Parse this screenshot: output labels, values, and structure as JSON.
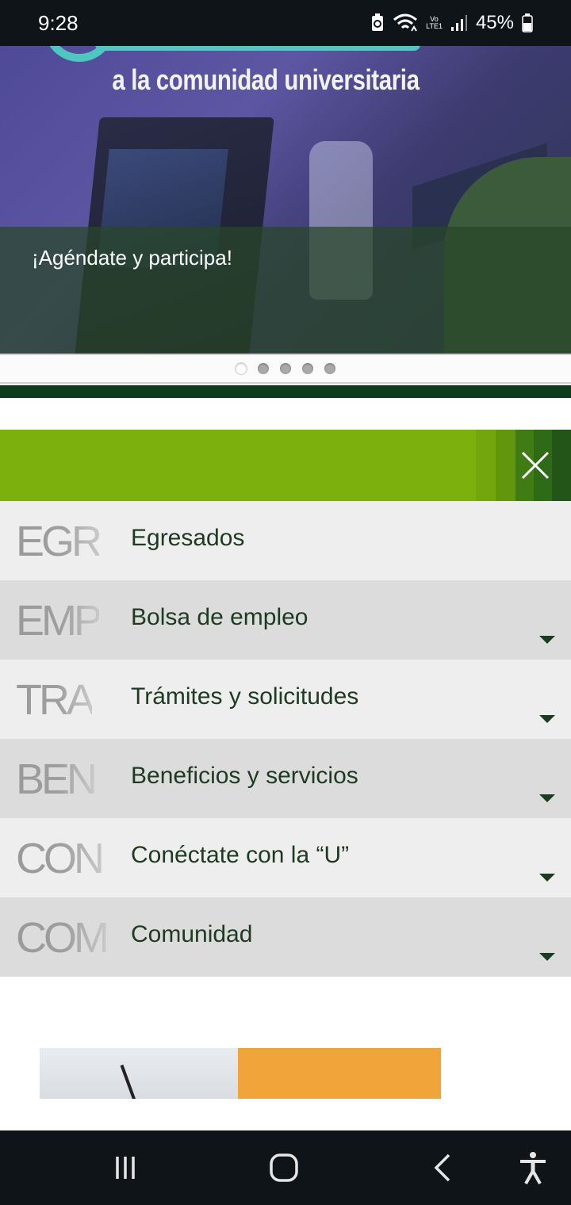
{
  "status_bar": {
    "time": "9:28",
    "battery_percent": "45%",
    "network_label_top": "Vo",
    "network_label_bottom": "LTE1",
    "icons": [
      "battery-saver-icon",
      "wifi-icon",
      "signal-icon",
      "battery-icon"
    ]
  },
  "hero": {
    "title": "a la comunidad universitaria",
    "caption": "¡Agéndate y participa!",
    "slide_count": 5,
    "active_slide": 1
  },
  "menu": {
    "header_color": "#7cb00d",
    "close_icon": "close-icon",
    "items": [
      {
        "abbr": "EGR",
        "label": "Egresados",
        "expandable": false
      },
      {
        "abbr": "EMP",
        "label": "Bolsa de empleo",
        "expandable": true
      },
      {
        "abbr": "TRA",
        "label": "Trámites y solicitudes",
        "expandable": true
      },
      {
        "abbr": "BEN",
        "label": "Beneficios y servicios",
        "expandable": true
      },
      {
        "abbr": "CON",
        "label": "Conéctate con la “U”",
        "expandable": true
      },
      {
        "abbr": "COM",
        "label": "Comunidad",
        "expandable": true
      }
    ]
  },
  "nav_bar": {
    "buttons": [
      "recents-icon",
      "home-icon",
      "back-icon",
      "accessibility-icon"
    ]
  },
  "colors": {
    "accent_green": "#7cb00d",
    "dark_green": "#0d3b1c",
    "text_green": "#1f3a22"
  }
}
